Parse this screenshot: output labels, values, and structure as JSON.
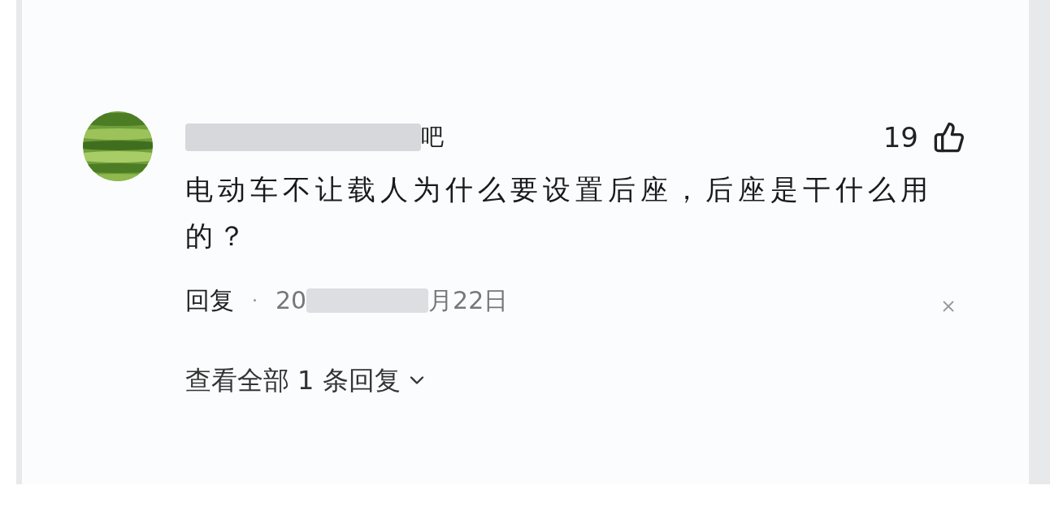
{
  "comment": {
    "author_visible": "吧",
    "likes": "19",
    "text": "电动车不让载人为什么要设置后座，后座是干什么用的？",
    "reply_label": "回复",
    "separator": "·",
    "date_start": "20",
    "date_end": "月22日",
    "view_replies": "查看全部 1 条回复"
  }
}
